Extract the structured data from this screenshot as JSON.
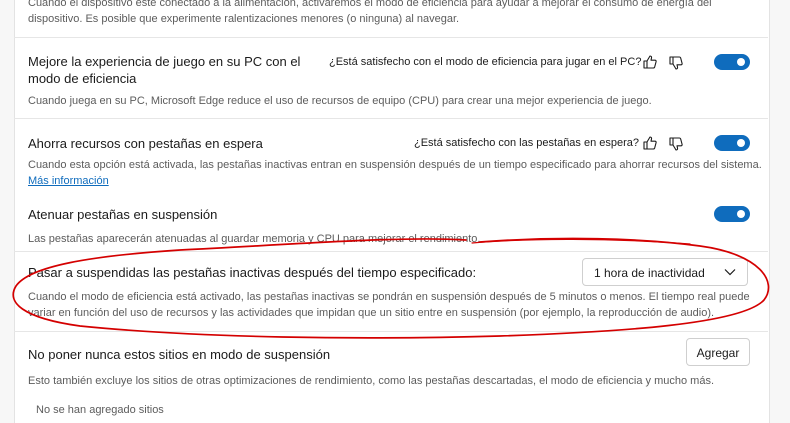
{
  "top": {
    "desc_line1": "Cuando el dispositivo esté conectado a la alimentación, activaremos el modo de eficiencia para ayudar a mejorar el consumo de energía del",
    "desc_line2": "dispositivo. Es posible que experimente ralentizaciones menores (o ninguna) al navegar."
  },
  "gaming": {
    "title_line1": "Mejore la experiencia de juego en su PC con el",
    "title_line2": "modo de eficiencia",
    "feedback_question": "¿Está satisfecho con el modo de eficiencia para jugar en el PC?",
    "desc": "Cuando juega en su PC, Microsoft Edge reduce el uso de recursos de equipo (CPU) para crear una mejor experiencia de juego.",
    "enabled": true
  },
  "sleeping_tabs": {
    "title": "Ahorra recursos con pestañas en espera",
    "feedback_question": "¿Está satisfecho con las pestañas en espera?",
    "desc": "Cuando esta opción está activada, las pestañas inactivas entran en suspensión después de un tiempo especificado para ahorrar recursos del sistema.",
    "link": "Más información",
    "enabled": true
  },
  "fade_tabs": {
    "title": "Atenuar pestañas en suspensión",
    "desc": "Las pestañas aparecerán atenuadas al guardar memoria y CPU para mejorar el rendimiento.",
    "enabled": true
  },
  "suspend_after": {
    "title": "Pasar a suspendidas las pestañas inactivas después del tiempo especificado:",
    "selected_option": "1 hora de inactividad",
    "desc_line1": "Cuando el modo de eficiencia está activado, las pestañas inactivas se pondrán en suspensión después de 5 minutos o menos. El tiempo real puede",
    "desc_line2": "variar en función del uso de recursos y las actividades que impidan que un sitio entre en suspensión (por ejemplo, la reproducción de audio)."
  },
  "never_sleep": {
    "title": "No poner nunca estos sitios en modo de suspensión",
    "add_button": "Agregar",
    "desc": "Esto también excluye los sitios de otras optimizaciones de rendimiento, como las pestañas descartadas, el modo de eficiencia y mucho más.",
    "empty": "No se han agregado sitios"
  },
  "colors": {
    "accent": "#0f6cbd",
    "annotation": "#d40000"
  },
  "icons": [
    "thumbs-up-icon",
    "thumbs-down-icon",
    "chevron-down-icon"
  ]
}
